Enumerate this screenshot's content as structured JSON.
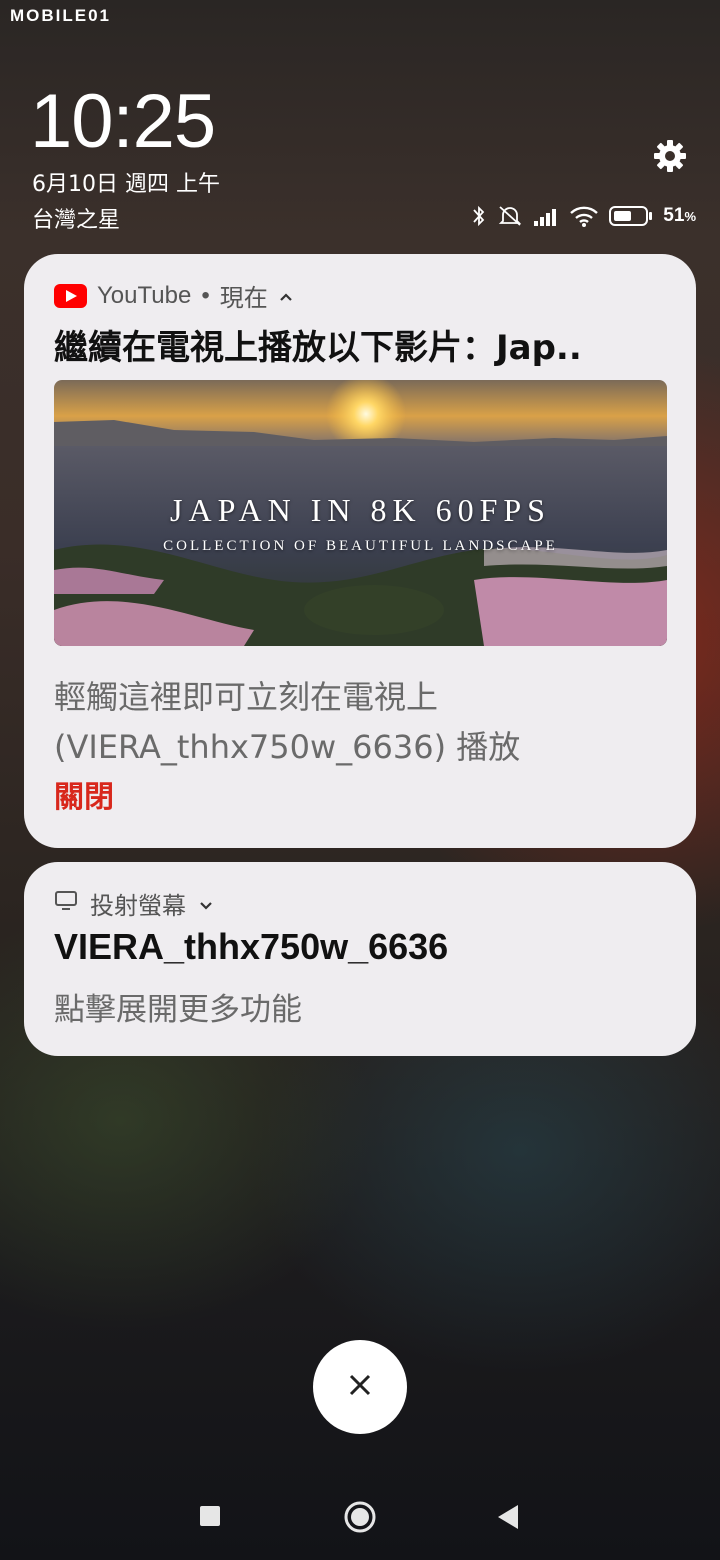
{
  "watermark": "MOBILE01",
  "lockscreen": {
    "time": "10:25",
    "date": "6月10日 週四 上午",
    "carrier": "台灣之星",
    "battery_pct": "51",
    "battery_unit": "%",
    "status_icons": [
      "bluetooth-icon",
      "do-not-disturb-icon",
      "signal-icon",
      "wifi-icon",
      "battery-icon"
    ],
    "settings_icon": "gear-icon"
  },
  "notification_youtube": {
    "app_name": "YouTube",
    "separator": "•",
    "time": "現在",
    "title": "繼續在電視上播放以下影片：Jap..",
    "thumbnail_title": "JAPAN IN 8K 60FPS",
    "thumbnail_subtitle": "COLLECTION OF BEAUTIFUL LANDSCAPE",
    "body_line1": "輕觸這裡即可立刻在電視上",
    "body_line2": "(VIERA_thhx750w_6636) 播放",
    "action_close": "關閉",
    "colors": {
      "brand": "#ff0000",
      "action": "#d8271c"
    }
  },
  "notification_cast": {
    "app_name": "投射螢幕",
    "title": "VIERA_thhx750w_6636",
    "subtitle": "點擊展開更多功能"
  },
  "dismiss_button": "close-icon",
  "navbar": [
    "recents-icon",
    "home-icon",
    "back-icon"
  ]
}
